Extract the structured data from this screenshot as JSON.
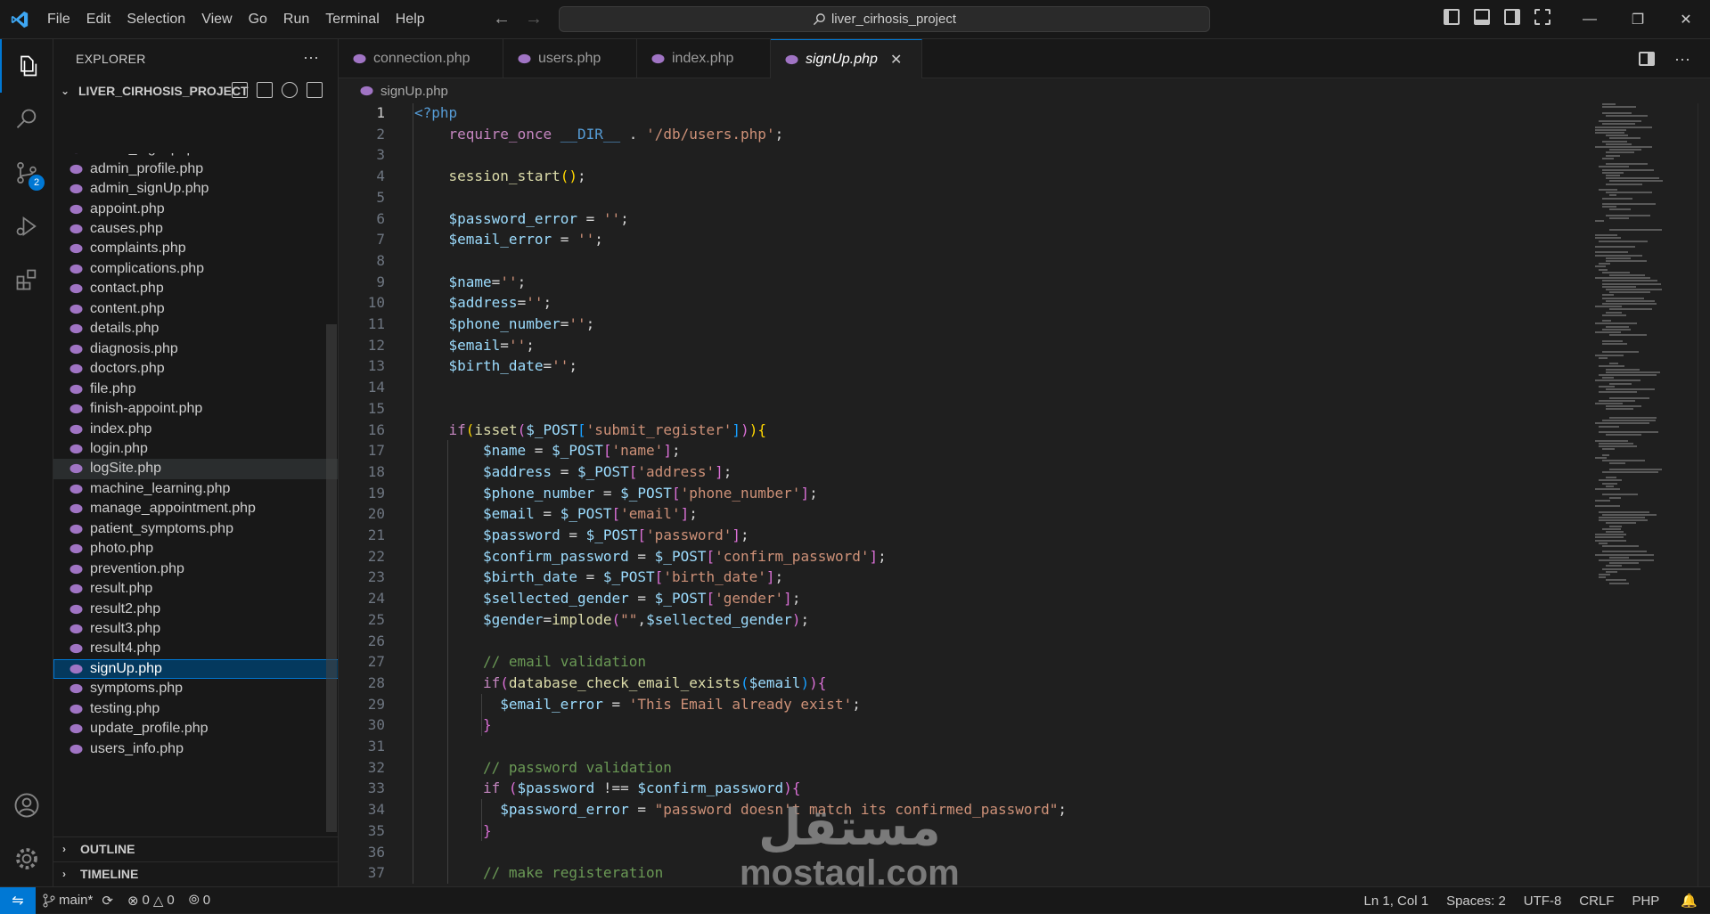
{
  "titlebar": {
    "menu": [
      "File",
      "Edit",
      "Selection",
      "View",
      "Go",
      "Run",
      "Terminal",
      "Help"
    ],
    "search_text": "liver_cirhosis_project",
    "back_icon": "arrow-left-icon",
    "forward_icon": "arrow-right-icon"
  },
  "activitybar": {
    "items": [
      "explorer-icon",
      "search-icon",
      "source-control-icon",
      "run-debug-icon",
      "extensions-icon"
    ],
    "source_control_badge": "2",
    "bottom": [
      "account-icon",
      "manage-gear-icon"
    ]
  },
  "sidebar": {
    "title": "EXPLORER",
    "project": "LIVER_CIRHOSIS_PROJECT",
    "files": [
      "admin_login.php",
      "admin_profile.php",
      "admin_signUp.php",
      "appoint.php",
      "causes.php",
      "complaints.php",
      "complications.php",
      "contact.php",
      "content.php",
      "details.php",
      "diagnosis.php",
      "doctors.php",
      "file.php",
      "finish-appoint.php",
      "index.php",
      "login.php",
      "logSite.php",
      "machine_learning.php",
      "manage_appointment.php",
      "patient_symptoms.php",
      "photo.php",
      "prevention.php",
      "result.php",
      "result2.php",
      "result3.php",
      "result4.php",
      "signUp.php",
      "symptoms.php",
      "testing.php",
      "update_profile.php",
      "users_info.php"
    ],
    "hovered_file": "logSite.php",
    "selected_file": "signUp.php",
    "sections": [
      "OUTLINE",
      "TIMELINE"
    ]
  },
  "tabs": [
    {
      "label": "connection.php",
      "active": false
    },
    {
      "label": "users.php",
      "active": false
    },
    {
      "label": "index.php",
      "active": false
    },
    {
      "label": "signUp.php",
      "active": true
    }
  ],
  "breadcrumb": "signUp.php",
  "editor": {
    "lines": [
      {
        "n": "1",
        "indent": 0,
        "tokens": [
          [
            "tag",
            "<?php"
          ]
        ]
      },
      {
        "n": "2",
        "indent": 1,
        "tokens": [
          [
            "kw",
            "require_once"
          ],
          [
            "pl",
            " "
          ],
          [
            "cst",
            "__DIR__"
          ],
          [
            "pl",
            " . "
          ],
          [
            "str",
            "'/db/users.php'"
          ],
          [
            "pl",
            ";"
          ]
        ]
      },
      {
        "n": "3",
        "indent": 1,
        "tokens": []
      },
      {
        "n": "4",
        "indent": 1,
        "tokens": [
          [
            "fn",
            "session_start"
          ],
          [
            "br1",
            "()"
          ],
          [
            "pl",
            ";"
          ]
        ]
      },
      {
        "n": "5",
        "indent": 1,
        "tokens": []
      },
      {
        "n": "6",
        "indent": 1,
        "tokens": [
          [
            "var",
            "$password_error"
          ],
          [
            "pl",
            " = "
          ],
          [
            "str",
            "''"
          ],
          [
            "pl",
            ";"
          ]
        ]
      },
      {
        "n": "7",
        "indent": 1,
        "tokens": [
          [
            "var",
            "$email_error"
          ],
          [
            "pl",
            " = "
          ],
          [
            "str",
            "''"
          ],
          [
            "pl",
            ";"
          ]
        ]
      },
      {
        "n": "8",
        "indent": 1,
        "tokens": []
      },
      {
        "n": "9",
        "indent": 1,
        "tokens": [
          [
            "var",
            "$name"
          ],
          [
            "pl",
            "="
          ],
          [
            "str",
            "''"
          ],
          [
            "pl",
            ";"
          ]
        ]
      },
      {
        "n": "10",
        "indent": 1,
        "tokens": [
          [
            "var",
            "$address"
          ],
          [
            "pl",
            "="
          ],
          [
            "str",
            "''"
          ],
          [
            "pl",
            ";"
          ]
        ]
      },
      {
        "n": "11",
        "indent": 1,
        "tokens": [
          [
            "var",
            "$phone_number"
          ],
          [
            "pl",
            "="
          ],
          [
            "str",
            "''"
          ],
          [
            "pl",
            ";"
          ]
        ]
      },
      {
        "n": "12",
        "indent": 1,
        "tokens": [
          [
            "var",
            "$email"
          ],
          [
            "pl",
            "="
          ],
          [
            "str",
            "''"
          ],
          [
            "pl",
            ";"
          ]
        ]
      },
      {
        "n": "13",
        "indent": 1,
        "tokens": [
          [
            "var",
            "$birth_date"
          ],
          [
            "pl",
            "="
          ],
          [
            "str",
            "''"
          ],
          [
            "pl",
            ";"
          ]
        ]
      },
      {
        "n": "14",
        "indent": 1,
        "tokens": []
      },
      {
        "n": "15",
        "indent": 1,
        "tokens": []
      },
      {
        "n": "16",
        "indent": 1,
        "tokens": [
          [
            "kw",
            "if"
          ],
          [
            "br1",
            "("
          ],
          [
            "fn",
            "isset"
          ],
          [
            "br2",
            "("
          ],
          [
            "var",
            "$_POST"
          ],
          [
            "br3",
            "["
          ],
          [
            "str",
            "'submit_register'"
          ],
          [
            "br3",
            "]"
          ],
          [
            "br2",
            ")"
          ],
          [
            "br1",
            ")"
          ],
          [
            "br1",
            "{"
          ]
        ]
      },
      {
        "n": "17",
        "indent": 2,
        "tokens": [
          [
            "var",
            "$name"
          ],
          [
            "pl",
            " = "
          ],
          [
            "var",
            "$_POST"
          ],
          [
            "br2",
            "["
          ],
          [
            "str",
            "'name'"
          ],
          [
            "br2",
            "]"
          ],
          [
            "pl",
            ";"
          ]
        ]
      },
      {
        "n": "18",
        "indent": 2,
        "tokens": [
          [
            "var",
            "$address"
          ],
          [
            "pl",
            " = "
          ],
          [
            "var",
            "$_POST"
          ],
          [
            "br2",
            "["
          ],
          [
            "str",
            "'address'"
          ],
          [
            "br2",
            "]"
          ],
          [
            "pl",
            ";"
          ]
        ]
      },
      {
        "n": "19",
        "indent": 2,
        "tokens": [
          [
            "var",
            "$phone_number"
          ],
          [
            "pl",
            " = "
          ],
          [
            "var",
            "$_POST"
          ],
          [
            "br2",
            "["
          ],
          [
            "str",
            "'phone_number'"
          ],
          [
            "br2",
            "]"
          ],
          [
            "pl",
            ";"
          ]
        ]
      },
      {
        "n": "20",
        "indent": 2,
        "tokens": [
          [
            "var",
            "$email"
          ],
          [
            "pl",
            " = "
          ],
          [
            "var",
            "$_POST"
          ],
          [
            "br2",
            "["
          ],
          [
            "str",
            "'email'"
          ],
          [
            "br2",
            "]"
          ],
          [
            "pl",
            ";"
          ]
        ]
      },
      {
        "n": "21",
        "indent": 2,
        "tokens": [
          [
            "var",
            "$password"
          ],
          [
            "pl",
            " = "
          ],
          [
            "var",
            "$_POST"
          ],
          [
            "br2",
            "["
          ],
          [
            "str",
            "'password'"
          ],
          [
            "br2",
            "]"
          ],
          [
            "pl",
            ";"
          ]
        ]
      },
      {
        "n": "22",
        "indent": 2,
        "tokens": [
          [
            "var",
            "$confirm_password"
          ],
          [
            "pl",
            " = "
          ],
          [
            "var",
            "$_POST"
          ],
          [
            "br2",
            "["
          ],
          [
            "str",
            "'confirm_password'"
          ],
          [
            "br2",
            "]"
          ],
          [
            "pl",
            ";"
          ]
        ]
      },
      {
        "n": "23",
        "indent": 2,
        "tokens": [
          [
            "var",
            "$birth_date"
          ],
          [
            "pl",
            " = "
          ],
          [
            "var",
            "$_POST"
          ],
          [
            "br2",
            "["
          ],
          [
            "str",
            "'birth_date'"
          ],
          [
            "br2",
            "]"
          ],
          [
            "pl",
            ";"
          ]
        ]
      },
      {
        "n": "24",
        "indent": 2,
        "tokens": [
          [
            "var",
            "$sellected_gender"
          ],
          [
            "pl",
            " = "
          ],
          [
            "var",
            "$_POST"
          ],
          [
            "br2",
            "["
          ],
          [
            "str",
            "'gender'"
          ],
          [
            "br2",
            "]"
          ],
          [
            "pl",
            ";"
          ]
        ]
      },
      {
        "n": "25",
        "indent": 2,
        "tokens": [
          [
            "var",
            "$gender"
          ],
          [
            "pl",
            "="
          ],
          [
            "fn",
            "implode"
          ],
          [
            "br2",
            "("
          ],
          [
            "str",
            "\"\""
          ],
          [
            "pl",
            ","
          ],
          [
            "var",
            "$sellected_gender"
          ],
          [
            "br2",
            ")"
          ],
          [
            "pl",
            ";"
          ]
        ]
      },
      {
        "n": "26",
        "indent": 2,
        "tokens": []
      },
      {
        "n": "27",
        "indent": 2,
        "tokens": [
          [
            "cmt",
            "// email validation"
          ]
        ]
      },
      {
        "n": "28",
        "indent": 2,
        "tokens": [
          [
            "kw",
            "if"
          ],
          [
            "br2",
            "("
          ],
          [
            "fn",
            "database_check_email_exists"
          ],
          [
            "br3",
            "("
          ],
          [
            "var",
            "$email"
          ],
          [
            "br3",
            ")"
          ],
          [
            "br2",
            ")"
          ],
          [
            "br2",
            "{"
          ]
        ]
      },
      {
        "n": "29",
        "indent": 2.5,
        "tokens": [
          [
            "var",
            "$email_error"
          ],
          [
            "pl",
            " = "
          ],
          [
            "str",
            "'This Email already exist'"
          ],
          [
            "pl",
            ";"
          ]
        ]
      },
      {
        "n": "30",
        "indent": 2,
        "tokens": [
          [
            "br2",
            "}"
          ]
        ]
      },
      {
        "n": "31",
        "indent": 2,
        "tokens": []
      },
      {
        "n": "32",
        "indent": 2,
        "tokens": [
          [
            "cmt",
            "// password validation"
          ]
        ]
      },
      {
        "n": "33",
        "indent": 2,
        "tokens": [
          [
            "kw",
            "if"
          ],
          [
            "pl",
            " "
          ],
          [
            "br2",
            "("
          ],
          [
            "var",
            "$password"
          ],
          [
            "pl",
            " !== "
          ],
          [
            "var",
            "$confirm_password"
          ],
          [
            "br2",
            ")"
          ],
          [
            "br2",
            "{"
          ]
        ]
      },
      {
        "n": "34",
        "indent": 2.5,
        "tokens": [
          [
            "var",
            "$password_error"
          ],
          [
            "pl",
            " = "
          ],
          [
            "str",
            "\"password doesn't match its confirmed_password\""
          ],
          [
            "pl",
            ";"
          ]
        ]
      },
      {
        "n": "35",
        "indent": 2,
        "tokens": [
          [
            "br2",
            "}"
          ]
        ]
      },
      {
        "n": "36",
        "indent": 2,
        "tokens": []
      },
      {
        "n": "37",
        "indent": 2,
        "tokens": [
          [
            "cmt",
            "// make registeration"
          ]
        ]
      }
    ]
  },
  "watermark": {
    "arabic": "مستقل",
    "latin": "mostaql.com"
  },
  "statusbar": {
    "branch": "main*",
    "errors": "0",
    "warnings": "0",
    "ports": "0",
    "position": "Ln 1, Col 1",
    "spaces": "Spaces: 2",
    "encoding": "UTF-8",
    "eol": "CRLF",
    "language": "PHP"
  },
  "colors": {
    "accent": "#0078d4",
    "background": "#1f1f1f",
    "sidebar": "#181818"
  }
}
